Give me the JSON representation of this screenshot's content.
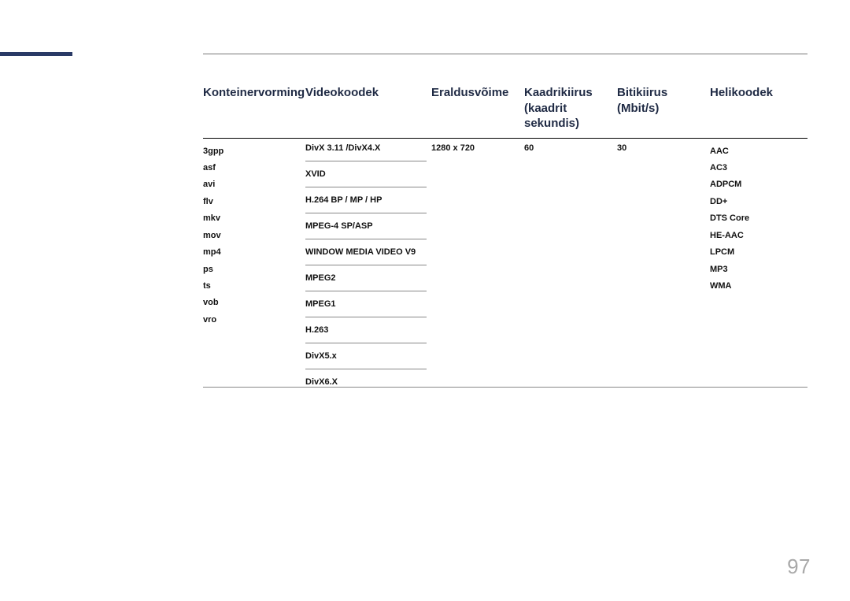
{
  "headers": {
    "col1": "Konteinervorming",
    "col2": "Videokoodek",
    "col3": "Eraldusvõime",
    "col4": "Kaadrikiirus (kaadrit sekundis)",
    "col5": "Bitikiirus (Mbit/s)",
    "col6": "Helikoodek"
  },
  "containers": [
    "3gpp",
    "asf",
    "avi",
    "flv",
    "mkv",
    "mov",
    "mp4",
    "ps",
    "ts",
    "vob",
    "vro"
  ],
  "videocodecs": [
    "DivX 3.11 /DivX4.X",
    "XVID",
    "H.264 BP / MP / HP",
    "MPEG-4 SP/ASP",
    "WINDOW MEDIA VIDEO V9",
    "MPEG2",
    "MPEG1",
    "H.263",
    "DivX5.x",
    "DivX6.X"
  ],
  "resolution": "1280 x 720",
  "framerate": "60",
  "bitrate": "30",
  "audiocodecs": [
    "AAC",
    "AC3",
    "ADPCM",
    "DD+",
    "DTS Core",
    "HE-AAC",
    "LPCM",
    "MP3",
    "WMA"
  ],
  "page_number": "97"
}
